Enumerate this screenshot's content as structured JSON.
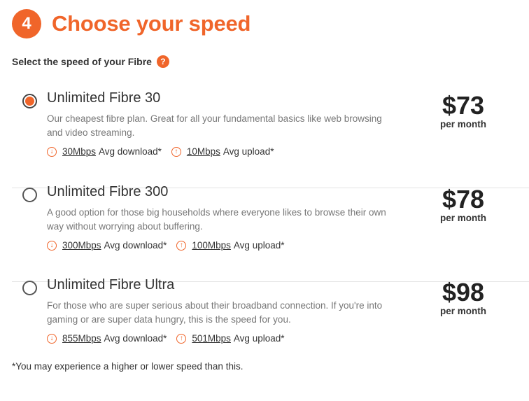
{
  "step": {
    "number": "4",
    "title": "Choose your speed"
  },
  "subheading": "Select the speed of your Fibre",
  "help_icon": "?",
  "download_label": "Avg download*",
  "upload_label": "Avg upload*",
  "plans": [
    {
      "name": "Unlimited Fibre 30",
      "description": "Our cheapest fibre plan. Great for all your fundamental basics like web browsing and video streaming.",
      "download": "30Mbps",
      "upload": "10Mbps",
      "price": "$73",
      "period": "per month",
      "selected": true
    },
    {
      "name": "Unlimited Fibre 300",
      "description": "A good option for those big households where everyone likes to browse their own way without worrying about buffering.",
      "download": "300Mbps",
      "upload": "100Mbps",
      "price": "$78",
      "period": "per month",
      "selected": false
    },
    {
      "name": "Unlimited Fibre Ultra",
      "description": "For those who are super serious about their broadband connection. If you're into gaming or are super data hungry, this is the speed for you.",
      "download": "855Mbps",
      "upload": "501Mbps",
      "price": "$98",
      "period": "per month",
      "selected": false
    }
  ],
  "footnote": "*You may experience a higher or lower speed than this.",
  "colors": {
    "accent": "#f0652a"
  }
}
